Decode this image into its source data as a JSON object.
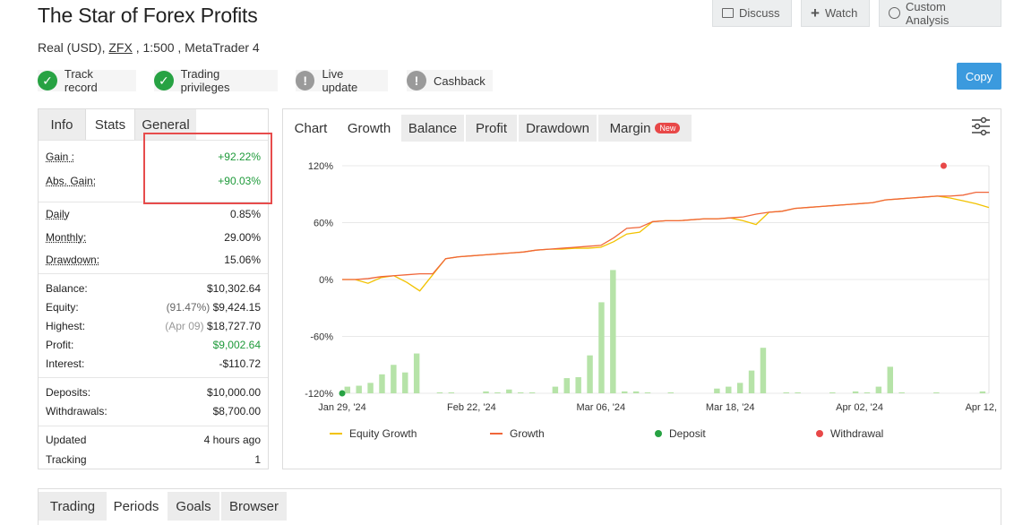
{
  "header": {
    "title": "The Star of Forex Profits",
    "account_type": "Real (USD),",
    "broker": "ZFX",
    "leverage_platform": ", 1:500 , MetaTrader 4"
  },
  "top_actions": {
    "discuss": "Discuss",
    "watch": "Watch",
    "custom_analysis": "Custom Analysis"
  },
  "badges": {
    "track_record": "Track record",
    "trading_privileges": "Trading privileges",
    "live_update": "Live update",
    "cashback": "Cashback"
  },
  "copy_label": "Copy",
  "left_tabs": {
    "info": "Info",
    "stats": "Stats",
    "general": "General"
  },
  "stats": {
    "gain_label": "Gain :",
    "gain": "+92.22%",
    "abs_gain_label": "Abs. Gain:",
    "abs_gain": "+90.03%",
    "daily_label": "Daily",
    "daily": "0.85%",
    "monthly_label": "Monthly:",
    "monthly": "29.00%",
    "drawdown_label": "Drawdown:",
    "drawdown": "15.06%",
    "balance_label": "Balance:",
    "balance": "$10,302.64",
    "equity_label": "Equity:",
    "equity_pct": "(91.47%)",
    "equity": "$9,424.15",
    "highest_label": "Highest:",
    "highest_date": "(Apr 09)",
    "highest": "$18,727.70",
    "profit_label": "Profit:",
    "profit": "$9,002.64",
    "interest_label": "Interest:",
    "interest": "-$110.72",
    "deposits_label": "Deposits:",
    "deposits": "$10,000.00",
    "withdrawals_label": "Withdrawals:",
    "withdrawals": "$8,700.00",
    "updated_label": "Updated",
    "updated": "4 hours ago",
    "tracking_label": "Tracking",
    "tracking": "1"
  },
  "chart_tabs": {
    "chart": "Chart",
    "growth": "Growth",
    "balance": "Balance",
    "profit": "Profit",
    "drawdown": "Drawdown",
    "margin": "Margin",
    "new_badge": "New"
  },
  "bottom_tabs": {
    "trading": "Trading",
    "periods": "Periods",
    "goals": "Goals",
    "browser": "Browser"
  },
  "colors": {
    "equity_growth": "#f2c200",
    "growth": "#f0663a",
    "bars": "#b6e3a8",
    "deposit": "#27a243",
    "withdrawal": "#e84848",
    "accent": "#3b9ade"
  },
  "chart_data": {
    "type": "line",
    "x_ticks": [
      "Jan 29, '24",
      "Feb 22, '24",
      "Mar 06, '24",
      "Mar 18, '24",
      "Apr 02, '24",
      "Apr 12, '24"
    ],
    "y_ticks": [
      "120%",
      "60%",
      "0%",
      "-60%",
      "-120%"
    ],
    "ylim": [
      -120,
      120
    ],
    "legend": [
      "Equity Growth",
      "Growth",
      "Deposit",
      "Withdrawal"
    ],
    "series": [
      {
        "name": "Growth",
        "values": [
          0,
          0,
          1,
          3,
          4,
          5,
          6,
          6,
          22,
          24,
          25,
          26,
          27,
          28,
          29,
          31,
          32,
          33,
          34,
          35,
          36,
          44,
          54,
          55,
          61,
          62,
          62,
          63,
          64,
          64,
          65,
          66,
          69,
          71,
          72,
          75,
          76,
          77,
          78,
          79,
          80,
          81,
          84,
          85,
          86,
          87,
          88,
          88,
          89,
          92,
          92
        ]
      },
      {
        "name": "Equity Growth",
        "values": [
          0,
          0,
          -4,
          2,
          4,
          -3,
          -12,
          5,
          22,
          24,
          25,
          26,
          27,
          28,
          29,
          31,
          32,
          32,
          33,
          33,
          34,
          40,
          48,
          50,
          61,
          62,
          62,
          63,
          64,
          64,
          65,
          62,
          58,
          71,
          72,
          75,
          76,
          77,
          78,
          79,
          80,
          81,
          84,
          85,
          86,
          87,
          88,
          86,
          83,
          80,
          76
        ]
      },
      {
        "name": "Bars",
        "values": [
          -113,
          -112,
          -109,
          -100,
          -90,
          -98,
          -78,
          -120,
          -119,
          -119,
          -120,
          -120,
          -118,
          -119,
          -116,
          -119,
          -119,
          -120,
          -113,
          -104,
          -103,
          -80,
          -24,
          10,
          -118,
          -118,
          -119,
          -120,
          -119,
          -120,
          -120,
          -120,
          -115,
          -113,
          -109,
          -96,
          -72,
          -120,
          -119,
          -119,
          -120,
          -120,
          -119,
          -120,
          -118,
          -119,
          -113,
          -92,
          -119,
          -120,
          -120,
          -119,
          -120,
          -120,
          -120,
          -118
        ]
      }
    ],
    "deposit_points": [
      {
        "x": 0,
        "y": -120
      }
    ],
    "withdrawal_points": [
      {
        "x": 0.93,
        "y": 120
      }
    ]
  }
}
